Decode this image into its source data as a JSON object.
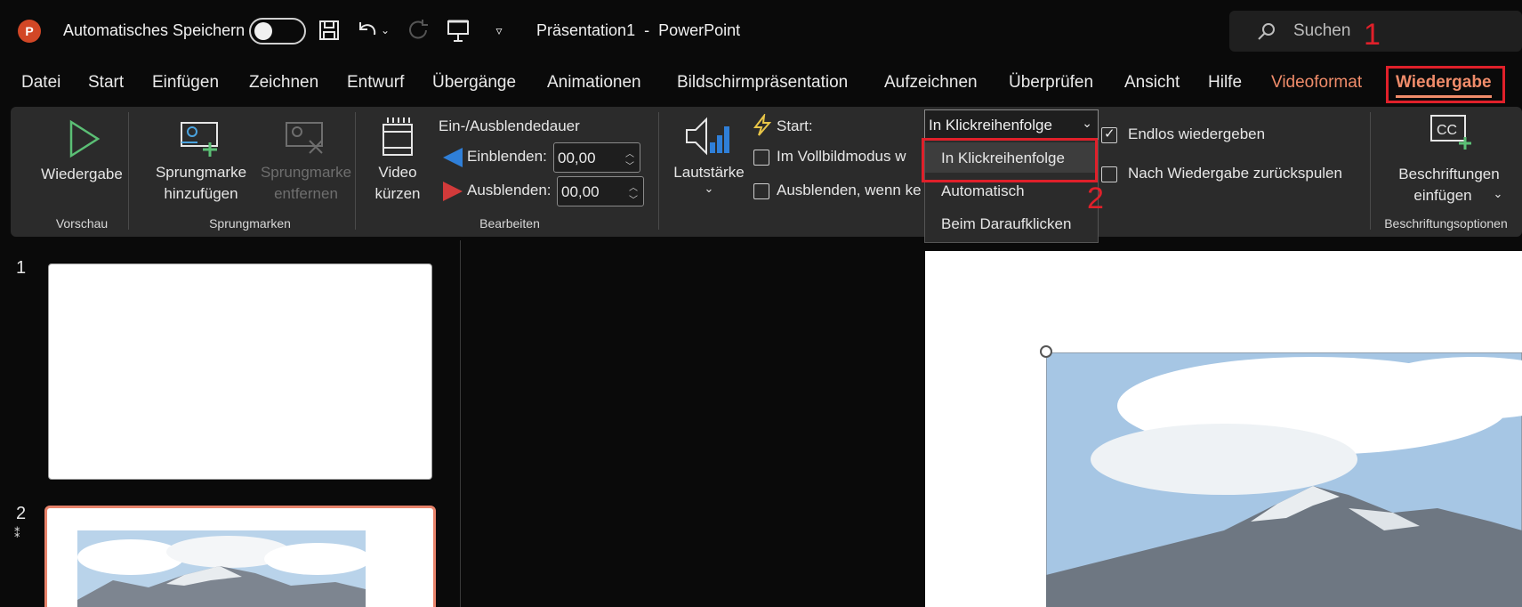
{
  "app": {
    "logo_letter": "P",
    "autosave_label": "Automatisches Speichern",
    "doc_title": "Präsentation1  -  PowerPoint",
    "search_placeholder": "Suchen",
    "accent_color": "#f08c6a"
  },
  "annotations": {
    "one": "1",
    "two": "2"
  },
  "tabs": [
    {
      "label": "Datei"
    },
    {
      "label": "Start"
    },
    {
      "label": "Einfügen"
    },
    {
      "label": "Zeichnen"
    },
    {
      "label": "Entwurf"
    },
    {
      "label": "Übergänge"
    },
    {
      "label": "Animationen"
    },
    {
      "label": "Bildschirmpräsentation"
    },
    {
      "label": "Aufzeichnen"
    },
    {
      "label": "Überprüfen"
    },
    {
      "label": "Ansicht"
    },
    {
      "label": "Hilfe"
    },
    {
      "label": "Videoformat"
    },
    {
      "label": "Wiedergabe"
    }
  ],
  "ribbon": {
    "play": {
      "label": "Wiedergabe",
      "group": "Vorschau"
    },
    "bookmarks": {
      "add_line1": "Sprungmarke",
      "add_line2": "hinzufügen",
      "remove_line1": "Sprungmarke",
      "remove_line2": "entfernen",
      "group": "Sprungmarken"
    },
    "edit": {
      "trim_line1": "Video",
      "trim_line2": "kürzen",
      "fade_title": "Ein-/Ausblendedauer",
      "fade_in_label": "Einblenden:",
      "fade_in_value": "00,00",
      "fade_out_label": "Ausblenden:",
      "fade_out_value": "00,00",
      "group": "Bearbeiten"
    },
    "volume": {
      "label": "Lautstärke"
    },
    "options": {
      "start_label": "Start:",
      "start_value": "In Klickreihenfolge",
      "fullscreen_label": "Im Vollbildmodus w",
      "hide_label": "Ausblenden, wenn ke",
      "loop_label": "Endlos wiedergeben",
      "loop_checked": true,
      "rewind_label": "Nach Wiedergabe zurückspulen",
      "rewind_checked": false
    },
    "captions": {
      "line1": "Beschriftungen",
      "line2": "einfügen",
      "icon_text": "CC",
      "group": "Beschriftungsoptionen"
    }
  },
  "start_dropdown": {
    "options": [
      "In Klickreihenfolge",
      "Automatisch",
      "Beim Daraufklicken"
    ],
    "selected": "In Klickreihenfolge"
  },
  "slides": [
    {
      "number": "1"
    },
    {
      "number": "2",
      "has_animation_marker": true
    }
  ]
}
